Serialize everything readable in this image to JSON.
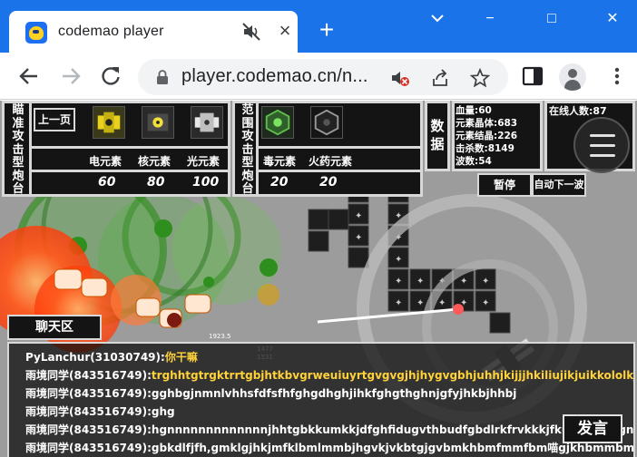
{
  "browser": {
    "tab_title": "codemao player",
    "url": "player.codemao.cn/n...",
    "new_tab_label": "+",
    "window_controls": {
      "minimize": "−",
      "maximize": "□",
      "close": "✕"
    }
  },
  "game": {
    "aim_tower": {
      "category_label": "瞄准攻击型炮台",
      "prev_page_label": "上一页",
      "elements": [
        "电元素",
        "核元素",
        "光元素"
      ],
      "costs": [
        "60",
        "80",
        "100"
      ]
    },
    "range_tower": {
      "category_label": "范围攻击型炮台",
      "elements": [
        "毒元素",
        "火药元素"
      ],
      "costs": [
        "20",
        "20"
      ]
    },
    "data_panel": {
      "label": "数据",
      "stats": {
        "hp": "血量:60",
        "crystal": "元素晶体:683",
        "node": "元素结晶:226",
        "kills": "击杀数:8149",
        "wave": "波数:54"
      }
    },
    "online": {
      "label": "在线人数:87"
    },
    "pause_label": "暂停",
    "auto_next_label": "自动下一波",
    "damage_numbers": [
      "1477",
      "1531",
      "1923.5"
    ],
    "chat": {
      "title": "聊天区",
      "send_label": "发言",
      "messages": [
        {
          "user": "PyLanchur(31030749):",
          "text": "你干嘛",
          "highlight": true
        },
        {
          "user": "雨境同学(843516749):",
          "text": "trghhtgtrgktrrtgbjhtkbvgrweuiuyrtgvgvgjhjhygvgbhjuhhjkijjjhkiliujikjuikkololkjikikik",
          "highlight": true
        },
        {
          "user": "雨境同学(843516749):",
          "text": "gghbgjnmnlvhhsfdfsfhfghgdhghjihkfghgthghnjgfyjhkbjhhbj",
          "highlight": false
        },
        {
          "user": "雨境同学(843516749):",
          "text": "ghg",
          "highlight": false
        },
        {
          "user": "雨境同学(843516749):",
          "text": "hgnnnnnnnnnnnnnjhhtgbkkumkkjdfghfidugvthbudfgbdlrkfrvkkkjfkuhtfghnbgnbdgnghvui",
          "highlight": false
        },
        {
          "user": "雨境同学(843516749):",
          "text": "gbkdlfjfh,gmklgjhkjmfklbmlmmbjhgvkjvkbtgjgvbmkhbmfmmfbm喵gjkhbmmbmjhvg",
          "highlight": false
        }
      ]
    }
  },
  "colors": {
    "browser_blue": "#1a73e8",
    "panel_bg": "#141414",
    "panel_border": "#d8d8d8",
    "chat_highlight": "#ffd23a",
    "fire_orange": "#ff5a1e",
    "poison_green": "#4caf3a"
  }
}
